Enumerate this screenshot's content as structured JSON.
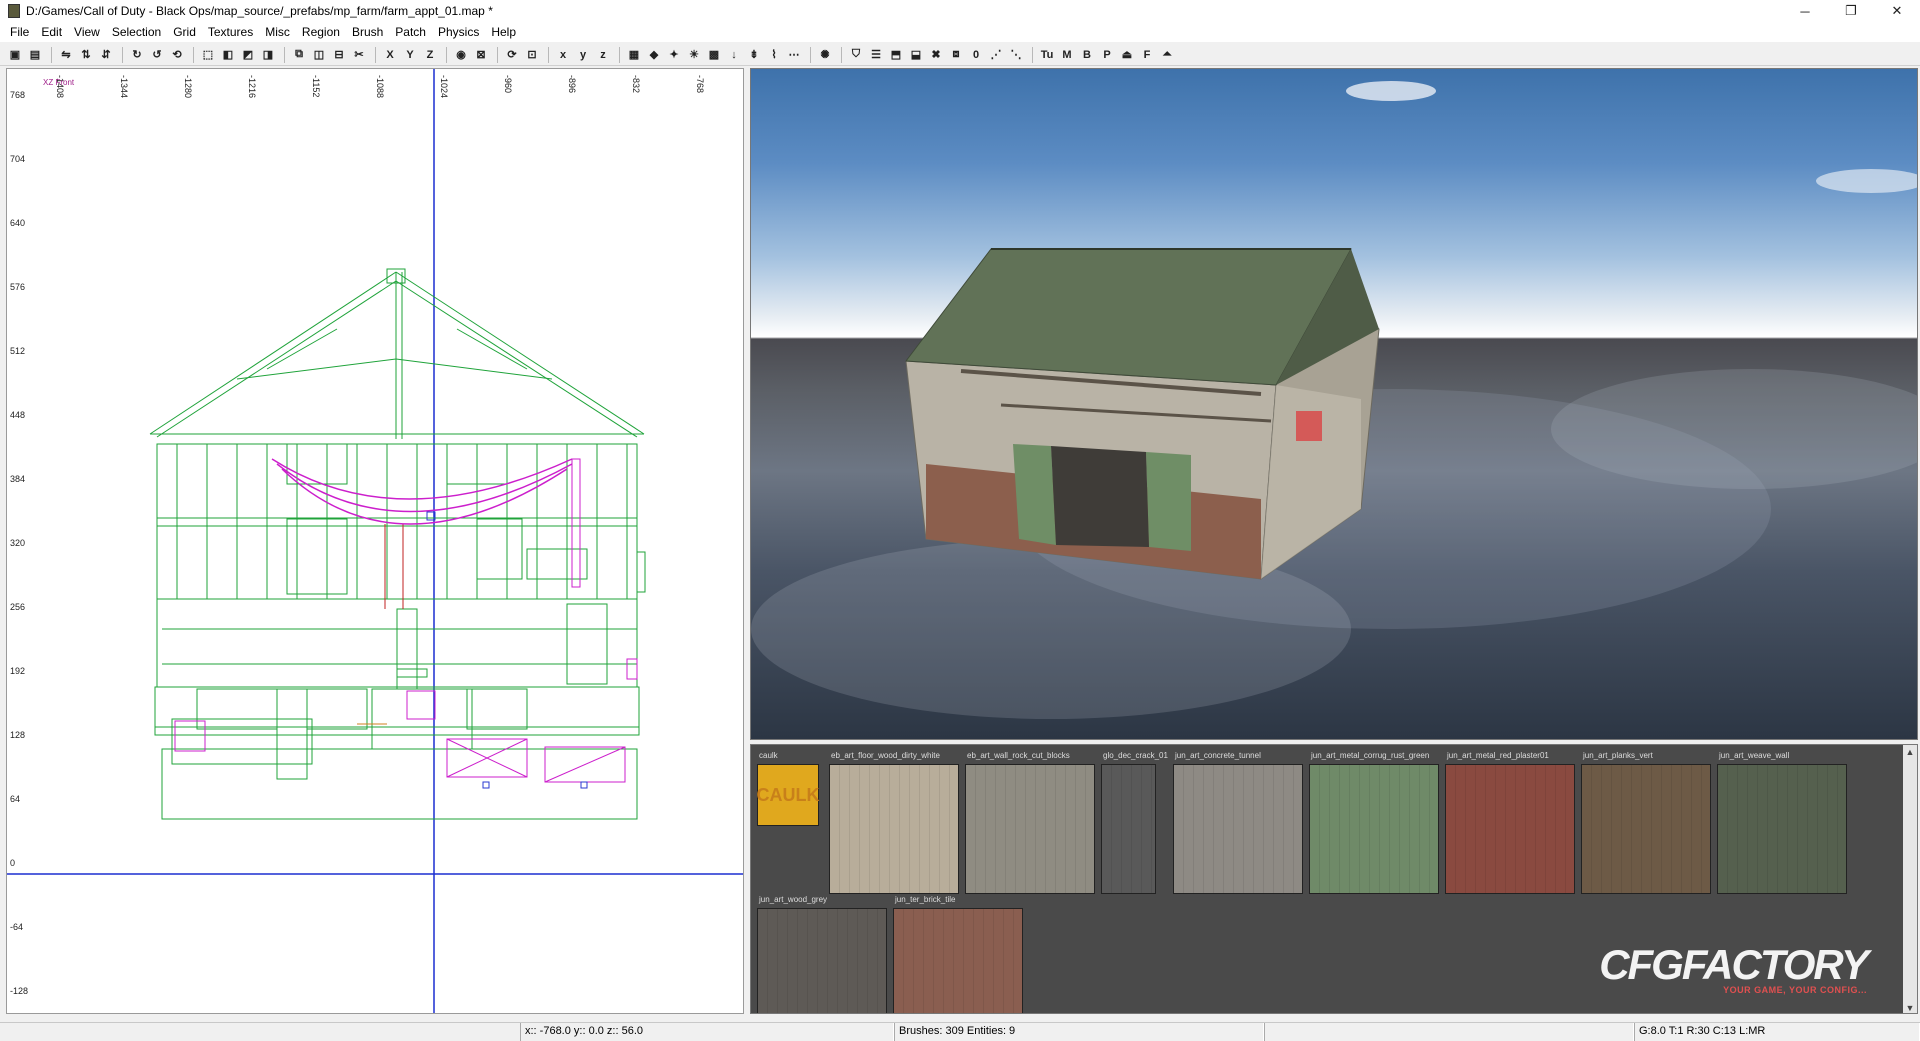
{
  "window": {
    "title": "D:/Games/Call of Duty - Black Ops/map_source/_prefabs/mp_farm/farm_appt_01.map *",
    "controls": {
      "minimize": "─",
      "maximize": "❐",
      "close": "✕"
    }
  },
  "menu": [
    "File",
    "Edit",
    "View",
    "Selection",
    "Grid",
    "Textures",
    "Misc",
    "Region",
    "Brush",
    "Patch",
    "Physics",
    "Help"
  ],
  "toolbar": {
    "groups": [
      [
        "open-icon",
        "save-icon"
      ],
      [
        "flip-x-icon",
        "flip-y-icon",
        "flip-z-icon"
      ],
      [
        "rotate-x-icon",
        "rotate-y-icon",
        "rotate-z-icon"
      ],
      [
        "select-complete-icon",
        "select-inside-icon",
        "select-touching-icon",
        "select-partial-icon"
      ],
      [
        "csg-subtract-icon",
        "csg-merge-icon",
        "csg-hollow-icon",
        "clipper-icon"
      ],
      [
        "view-xy-icon",
        "view-xz-icon",
        "view-yz-icon"
      ],
      [
        "camera-icon",
        "texture-lock-icon"
      ],
      [
        "change-view-icon",
        "cubic-clip-icon"
      ],
      [
        "x-axis-icon",
        "y-axis-icon",
        "z-axis-icon"
      ],
      [
        "show-patch-icon",
        "show-brush-icon",
        "show-models-icon",
        "show-lights-icon",
        "show-detail-icon",
        "drop-icon",
        "show-curve-icon",
        "show-nodes-icon",
        "show-paths-icon"
      ],
      [
        "light-preview-icon"
      ],
      [
        "filter-icon",
        "layers-icon",
        "prefab-icon",
        "prefab-ref-icon",
        "delete-icon",
        "model-icon",
        "zero-icon",
        "path-icon",
        "pathnode-icon"
      ]
    ],
    "text_buttons": [
      "Tu",
      "M",
      "B",
      "P",
      "⏏",
      "F",
      "⏶"
    ]
  },
  "ortho_view": {
    "label": "XZ Front",
    "x_ticks": [
      "-1408",
      "-1344",
      "-1280",
      "-1216",
      "-1152",
      "-1088",
      "-1024",
      "-960",
      "-896",
      "-832",
      "-768"
    ],
    "y_ticks": [
      "768",
      "704",
      "640",
      "576",
      "512",
      "448",
      "384",
      "320",
      "256",
      "192",
      "128",
      "64",
      "0",
      "-64",
      "-128"
    ]
  },
  "texture_browser": {
    "textures": [
      {
        "name": "caulk",
        "label": "CAULK",
        "color": "#e0a81e"
      },
      {
        "name": "eb_art_floor_wood_dirty_white",
        "color": "#b8ad9a"
      },
      {
        "name": "eb_art_wall_rock_cut_blocks",
        "color": "#8f8c82"
      },
      {
        "name": "glo_dec_crack_01",
        "color": "#595959"
      },
      {
        "name": "jun_art_concrete_tunnel",
        "color": "#8e8a84"
      },
      {
        "name": "jun_art_metal_corrug_rust_green",
        "color": "#6f8a68"
      },
      {
        "name": "jun_art_metal_red_plaster01",
        "color": "#8a4a40"
      },
      {
        "name": "jun_art_planks_vert",
        "color": "#6d5a46"
      },
      {
        "name": "jun_art_weave_wall",
        "color": "#55604e"
      },
      {
        "name": "jun_art_wood_grey",
        "color": "#5e5a56"
      },
      {
        "name": "jun_ter_brick_tile",
        "color": "#8a5e50"
      }
    ],
    "watermark": {
      "main": "CFGFACTORY",
      "sub": "YOUR GAME, YOUR CONFIG..."
    }
  },
  "statusbar": {
    "coords": "x:: -768.0  y:: 0.0  z:: 56.0",
    "counts": "Brushes: 309 Entities: 9",
    "grid": "G:8.0 T:1 R:30 C:13 L:MR"
  }
}
